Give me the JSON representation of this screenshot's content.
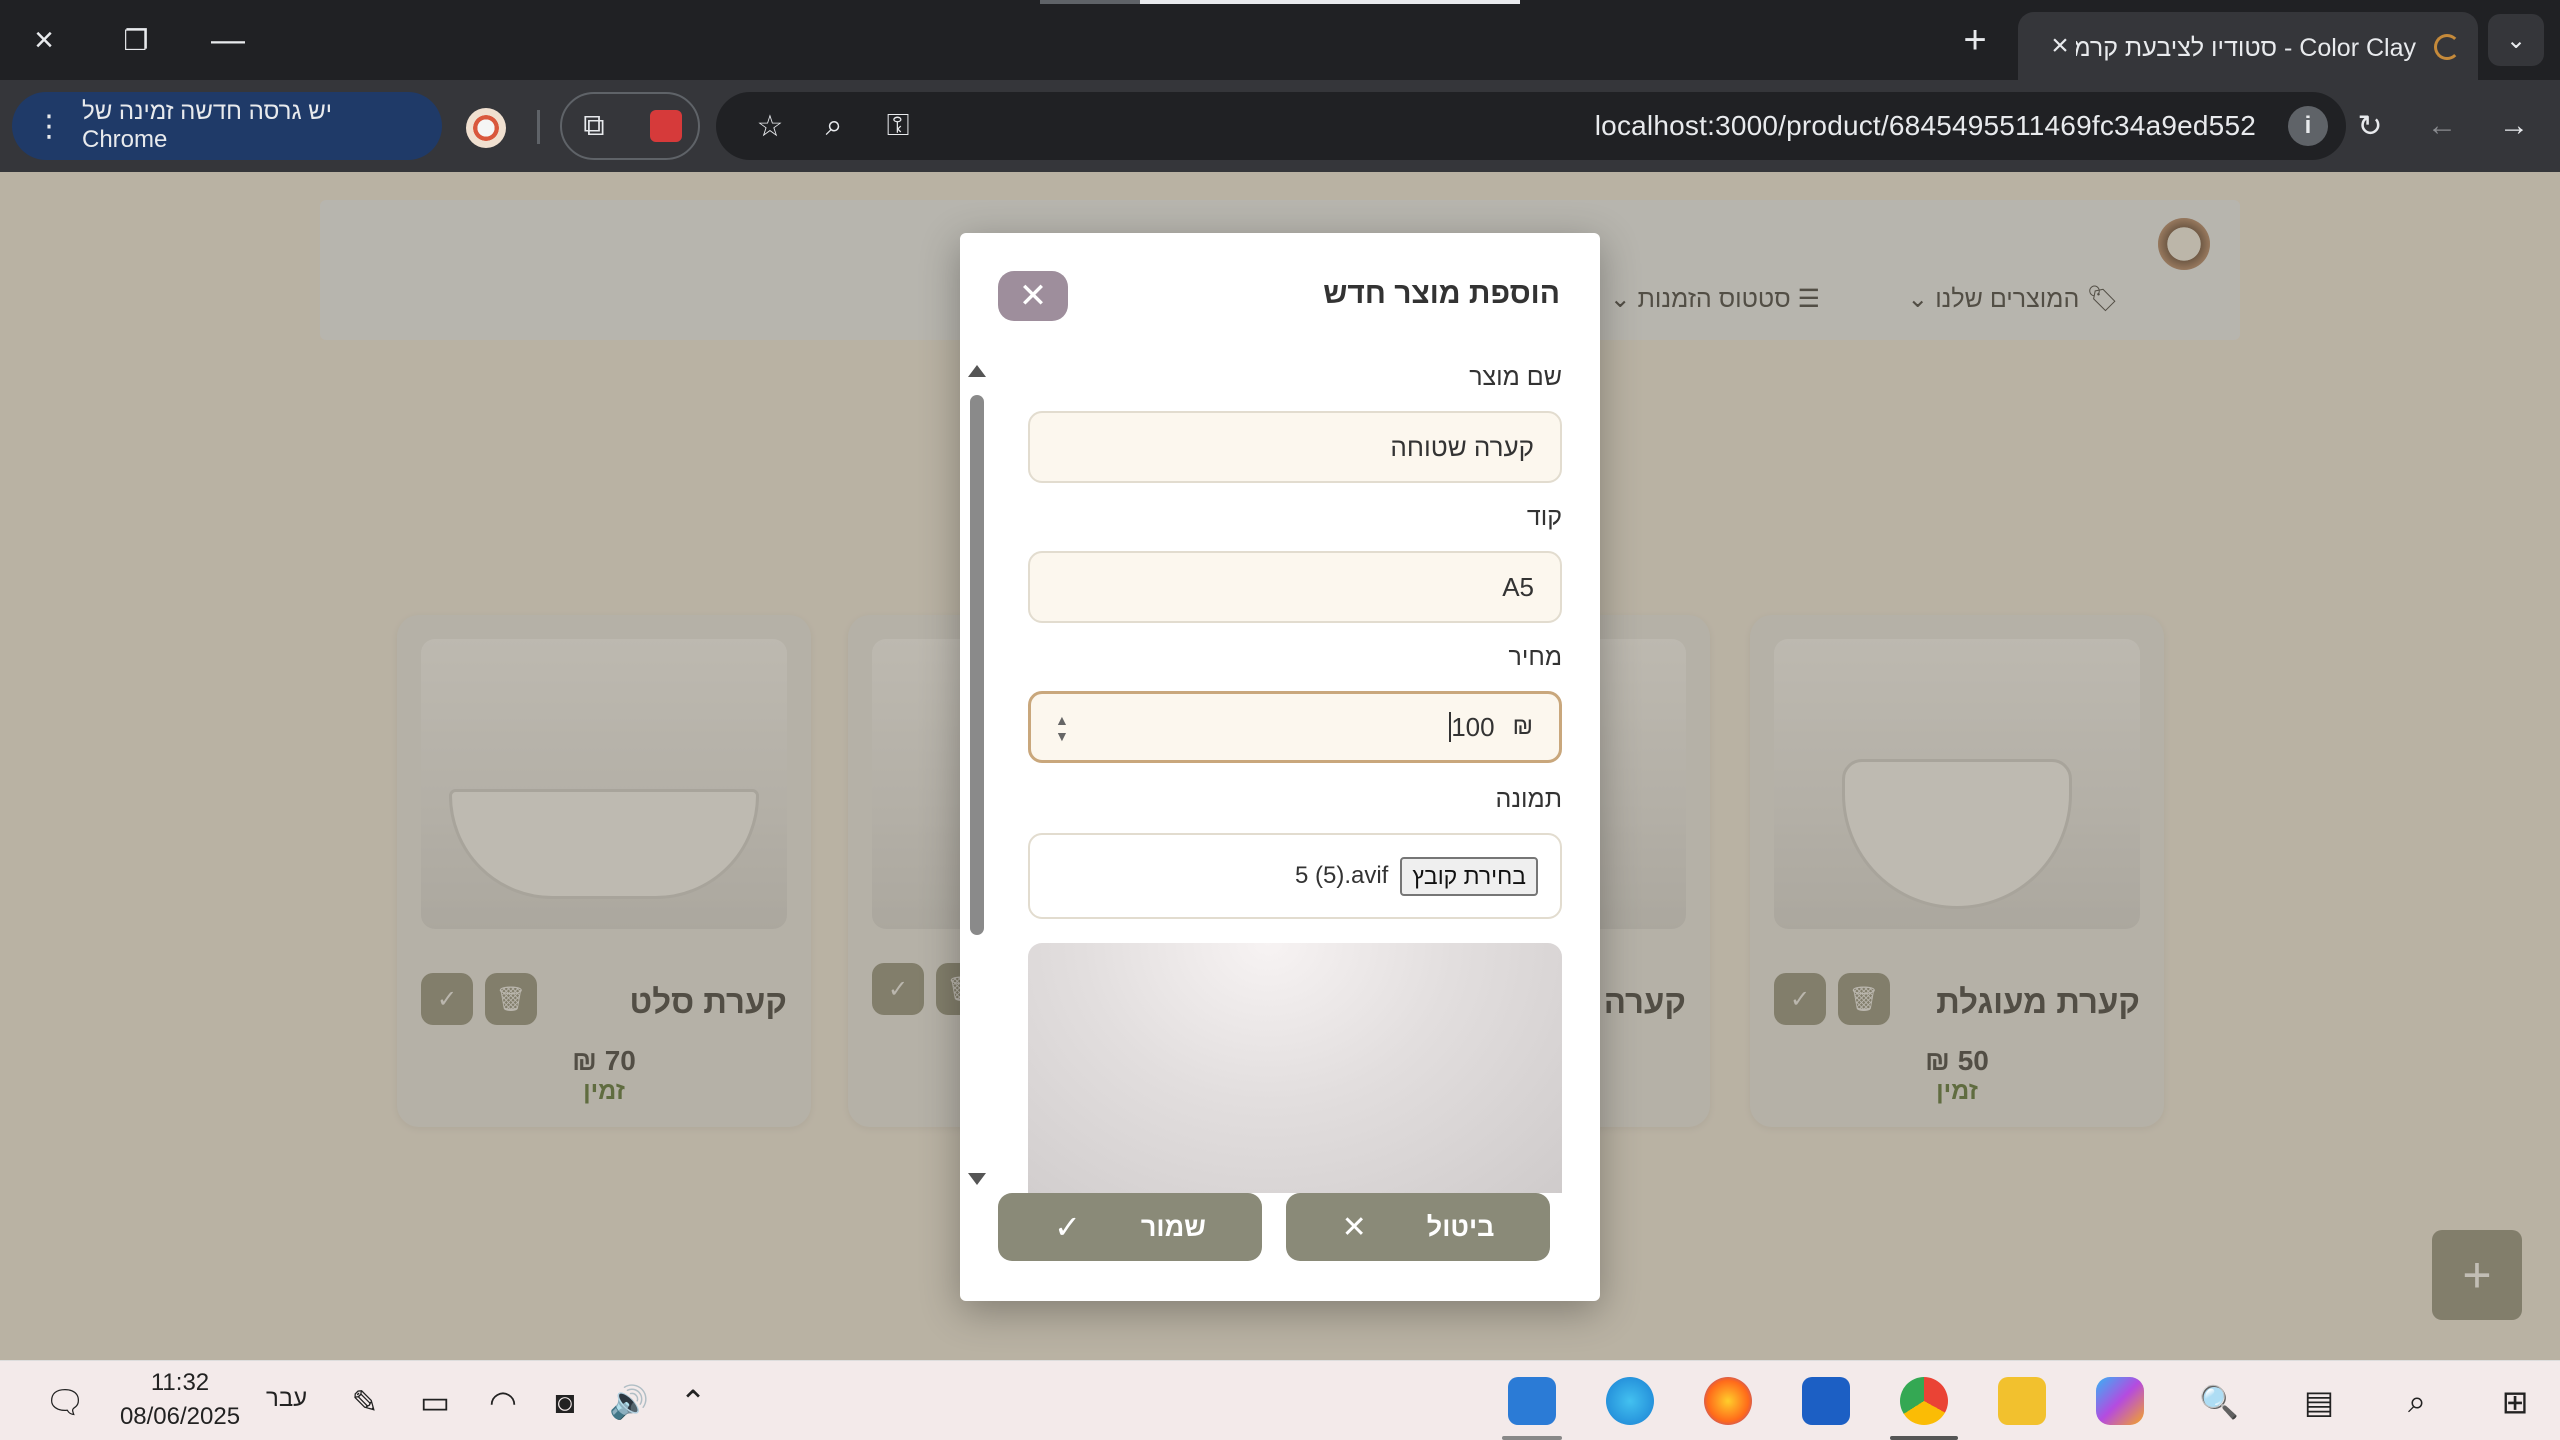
{
  "browser": {
    "tab_title": "Color Clay - סטודיו לציבעת קרמיקה",
    "url": "localhost:3000/product/6845495511469fc34a9ed552",
    "update_label": "יש גרסה חדשה זמינה של Chrome",
    "icons": {
      "close": "×",
      "restore": "❐",
      "minimize": "—",
      "new_tab": "+",
      "tab_list": "⌄",
      "star": "☆",
      "zoom": "⌕",
      "key": "⚿",
      "reload": "↻",
      "back": "←",
      "forward": "→",
      "info": "i",
      "dots": "⋮",
      "puzzle": "⧉"
    }
  },
  "nav": {
    "products": "המוצרים שלנו",
    "order_status": "סטטוס הזמנות"
  },
  "cards": [
    {
      "title": "קערת מעוגלת",
      "price": "50 ₪",
      "status": "זמין"
    },
    {
      "title": "קערה ...",
      "price": "",
      "status": ""
    },
    {
      "title": "קערת סלט",
      "price": "70 ₪",
      "status": "זמין"
    }
  ],
  "card_icons": {
    "check": "✓",
    "trash": "🗑",
    "fab": "+"
  },
  "modal": {
    "title": "הוספת מוצר חדש",
    "close_icon": "✕",
    "fields": {
      "name_label": "שם מוצר",
      "name_value": "קערה שטוחה",
      "code_label": "קוד",
      "code_value": "A5",
      "price_label": "מחיר",
      "price_value": "100",
      "currency": "₪",
      "image_label": "תמונה",
      "file_button": "בחירת קובץ",
      "file_name": "5 (5).avif"
    },
    "save_label": "שמור",
    "cancel_label": "ביטול",
    "save_icon": "✓",
    "cancel_icon": "✕"
  },
  "taskbar": {
    "time": "11:32",
    "date": "08/06/2025",
    "lang": "עבר",
    "notification_icon": "🗨",
    "chevron": "⌃"
  },
  "colors": {
    "accent": "#8a8a78",
    "close_btn": "#9e8e9c",
    "status_green": "#4d6b2a",
    "field_bg": "#fcf7ee"
  }
}
